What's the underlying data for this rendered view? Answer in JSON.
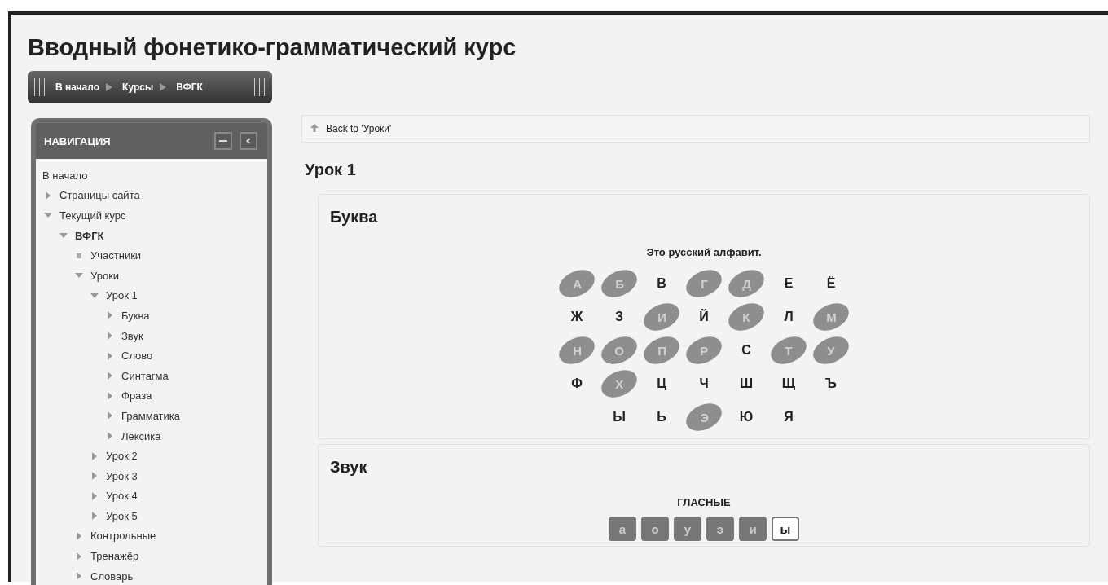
{
  "page_title": "Вводный фонетико-грамматический курс",
  "breadcrumb": [
    "В начало",
    "Курсы",
    "ВФГК"
  ],
  "navigation": {
    "title": "НАВИГАЦИЯ",
    "items": [
      {
        "label": "В начало",
        "kind": "plain"
      },
      {
        "label": "Страницы сайта",
        "kind": "branch",
        "expanded": false
      },
      {
        "label": "Текущий курс",
        "kind": "branch",
        "expanded": true,
        "children": [
          {
            "label": "ВФГК",
            "kind": "branch",
            "expanded": true,
            "bold": true,
            "children": [
              {
                "label": "Участники",
                "kind": "leaf"
              },
              {
                "label": "Уроки",
                "kind": "branch",
                "expanded": true,
                "children": [
                  {
                    "label": "Урок 1",
                    "kind": "branch",
                    "expanded": true,
                    "children": [
                      {
                        "label": "Буква",
                        "kind": "branch",
                        "expanded": false
                      },
                      {
                        "label": "Звук",
                        "kind": "branch",
                        "expanded": false
                      },
                      {
                        "label": "Слово",
                        "kind": "branch",
                        "expanded": false
                      },
                      {
                        "label": "Синтагма",
                        "kind": "branch",
                        "expanded": false
                      },
                      {
                        "label": "Фраза",
                        "kind": "branch",
                        "expanded": false
                      },
                      {
                        "label": "Грамматика",
                        "kind": "branch",
                        "expanded": false
                      },
                      {
                        "label": "Лексика",
                        "kind": "branch",
                        "expanded": false
                      }
                    ]
                  },
                  {
                    "label": "Урок 2",
                    "kind": "branch",
                    "expanded": false
                  },
                  {
                    "label": "Урок 3",
                    "kind": "branch",
                    "expanded": false
                  },
                  {
                    "label": "Урок 4",
                    "kind": "branch",
                    "expanded": false
                  },
                  {
                    "label": "Урок 5",
                    "kind": "branch",
                    "expanded": false
                  }
                ]
              },
              {
                "label": "Контрольные",
                "kind": "branch",
                "expanded": false
              },
              {
                "label": "Тренажёр",
                "kind": "branch",
                "expanded": false
              },
              {
                "label": "Словарь",
                "kind": "branch",
                "expanded": false
              }
            ]
          }
        ]
      }
    ]
  },
  "back_link": "Back to 'Уроки'",
  "lesson_title": "Урок 1",
  "sections": [
    {
      "title": "Буква",
      "kind": "alphabet",
      "caption": "Это русский алфавит.",
      "rows": [
        [
          {
            "letter": "А",
            "highlighted": true
          },
          {
            "letter": "Б",
            "highlighted": true
          },
          {
            "letter": "В",
            "highlighted": false
          },
          {
            "letter": "Г",
            "highlighted": true
          },
          {
            "letter": "Д",
            "highlighted": true
          },
          {
            "letter": "Е",
            "highlighted": false
          },
          {
            "letter": "Ё",
            "highlighted": false
          }
        ],
        [
          {
            "letter": "Ж",
            "highlighted": false
          },
          {
            "letter": "З",
            "highlighted": false
          },
          {
            "letter": "И",
            "highlighted": true
          },
          {
            "letter": "Й",
            "highlighted": false
          },
          {
            "letter": "К",
            "highlighted": true
          },
          {
            "letter": "Л",
            "highlighted": false
          },
          {
            "letter": "М",
            "highlighted": true
          }
        ],
        [
          {
            "letter": "Н",
            "highlighted": true
          },
          {
            "letter": "О",
            "highlighted": true
          },
          {
            "letter": "П",
            "highlighted": true
          },
          {
            "letter": "Р",
            "highlighted": true
          },
          {
            "letter": "С",
            "highlighted": false
          },
          {
            "letter": "Т",
            "highlighted": true
          },
          {
            "letter": "У",
            "highlighted": true
          }
        ],
        [
          {
            "letter": "Ф",
            "highlighted": false
          },
          {
            "letter": "Х",
            "highlighted": true
          },
          {
            "letter": "Ц",
            "highlighted": false
          },
          {
            "letter": "Ч",
            "highlighted": false
          },
          {
            "letter": "Ш",
            "highlighted": false
          },
          {
            "letter": "Щ",
            "highlighted": false
          },
          {
            "letter": "Ъ",
            "highlighted": false
          }
        ],
        [
          null,
          {
            "letter": "Ы",
            "highlighted": false
          },
          {
            "letter": "Ь",
            "highlighted": false
          },
          {
            "letter": "Э",
            "highlighted": true
          },
          {
            "letter": "Ю",
            "highlighted": false
          },
          {
            "letter": "Я",
            "highlighted": false
          },
          null
        ]
      ]
    },
    {
      "title": "Звук",
      "kind": "keys",
      "caption": "ГЛАСНЫЕ",
      "keys": [
        {
          "letter": "а",
          "selected": true
        },
        {
          "letter": "о",
          "selected": true
        },
        {
          "letter": "у",
          "selected": true
        },
        {
          "letter": "э",
          "selected": true
        },
        {
          "letter": "и",
          "selected": true
        },
        {
          "letter": "ы",
          "selected": false
        }
      ]
    }
  ]
}
